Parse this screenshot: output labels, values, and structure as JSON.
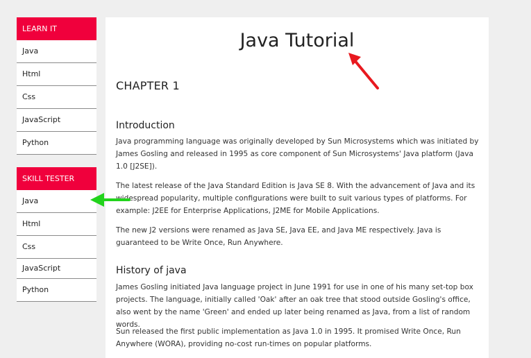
{
  "sidebar": {
    "learn": {
      "header": "LEARN IT",
      "items": [
        "Java",
        "Html",
        "Css",
        "JavaScript",
        "Python"
      ]
    },
    "skill": {
      "header": "SKILL TESTER",
      "items": [
        "Java",
        "Html",
        "Css",
        "JavaScript",
        "Python"
      ]
    }
  },
  "main": {
    "title": "Java Tutorial",
    "chapter": "CHAPTER 1",
    "intro_heading": "Introduction",
    "intro_p1": "Java programming language was originally developed by Sun Microsystems which was initiated by James Gosling and released in 1995 as core component of Sun Microsystems' Java platform (Java 1.0 [J2SE]).",
    "intro_p2": "The latest release of the Java Standard Edition is Java SE 8. With the advancement of Java and its widespread popularity, multiple configurations were built to suit various types of platforms. For example: J2EE for Enterprise Applications, J2ME for Mobile Applications.",
    "intro_p3": "The new J2 versions were renamed as Java SE, Java EE, and Java ME respectively. Java is guaranteed to be Write Once, Run Anywhere.",
    "history_heading": "History of java",
    "history_p1": "James Gosling initiated Java language project in June 1991 for use in one of his many set-top box projects. The language, initially called 'Oak' after an oak tree that stood outside Gosling's office, also went by the name 'Green' and ended up later being renamed as Java, from a list of random words.",
    "history_p2": "Sun released the first public implementation as Java 1.0 in 1995. It promised Write Once, Run Anywhere (WORA), providing no-cost run-times on popular platforms."
  },
  "annotations": {
    "red_arrow_color": "#e8191f",
    "green_arrow_color": "#22d31c"
  }
}
